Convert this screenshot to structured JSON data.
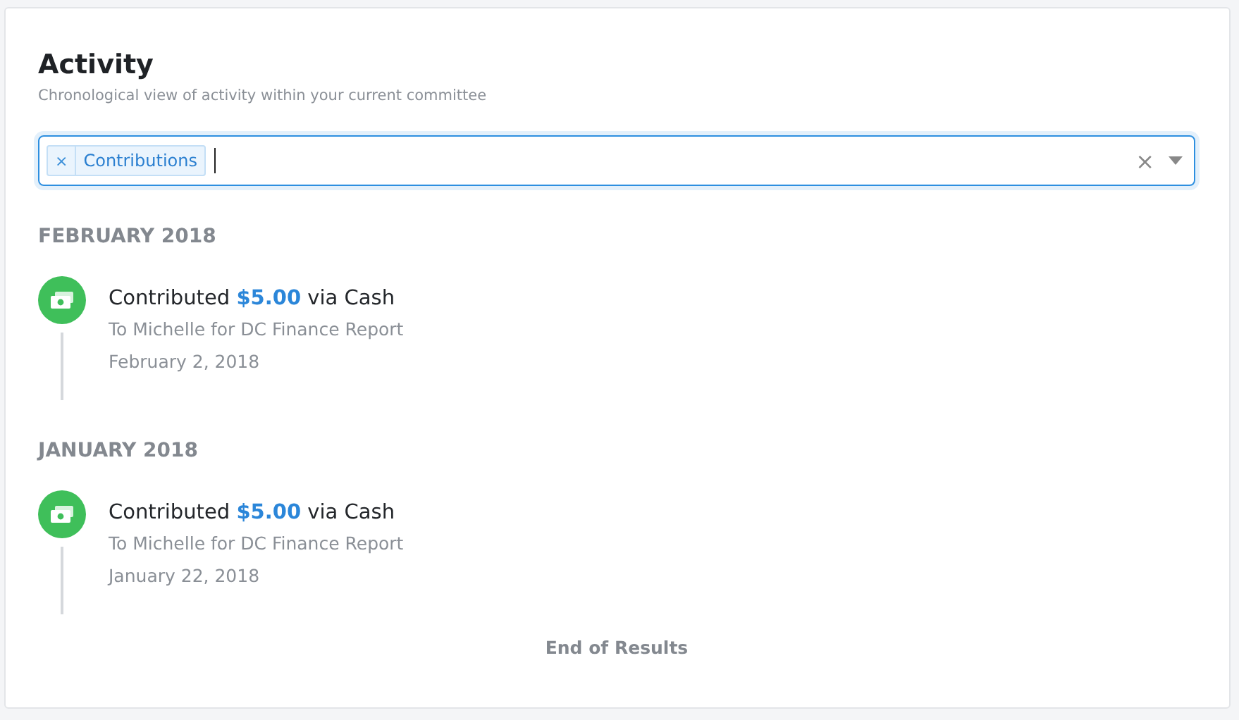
{
  "title": "Activity",
  "subtitle": "Chronological view of activity within your current committee",
  "filter": {
    "tags": [
      {
        "label": "Contributions",
        "remove": "×"
      }
    ],
    "clear": "×"
  },
  "groups": [
    {
      "heading": "FEBRUARY 2018",
      "items": [
        {
          "kind": "cash",
          "summary": "Contributed **$5.00** via Cash",
          "detail": "To Michelle for DC Finance Report",
          "date": "February 2, 2018"
        }
      ]
    },
    {
      "heading": "JANUARY 2018",
      "items": [
        {
          "kind": "cash",
          "summary": "Contributed **$5.00** via Cash",
          "detail": "To Michelle for DC Finance Report",
          "date": "January 22, 2018"
        }
      ]
    }
  ],
  "footer": "End of Results"
}
